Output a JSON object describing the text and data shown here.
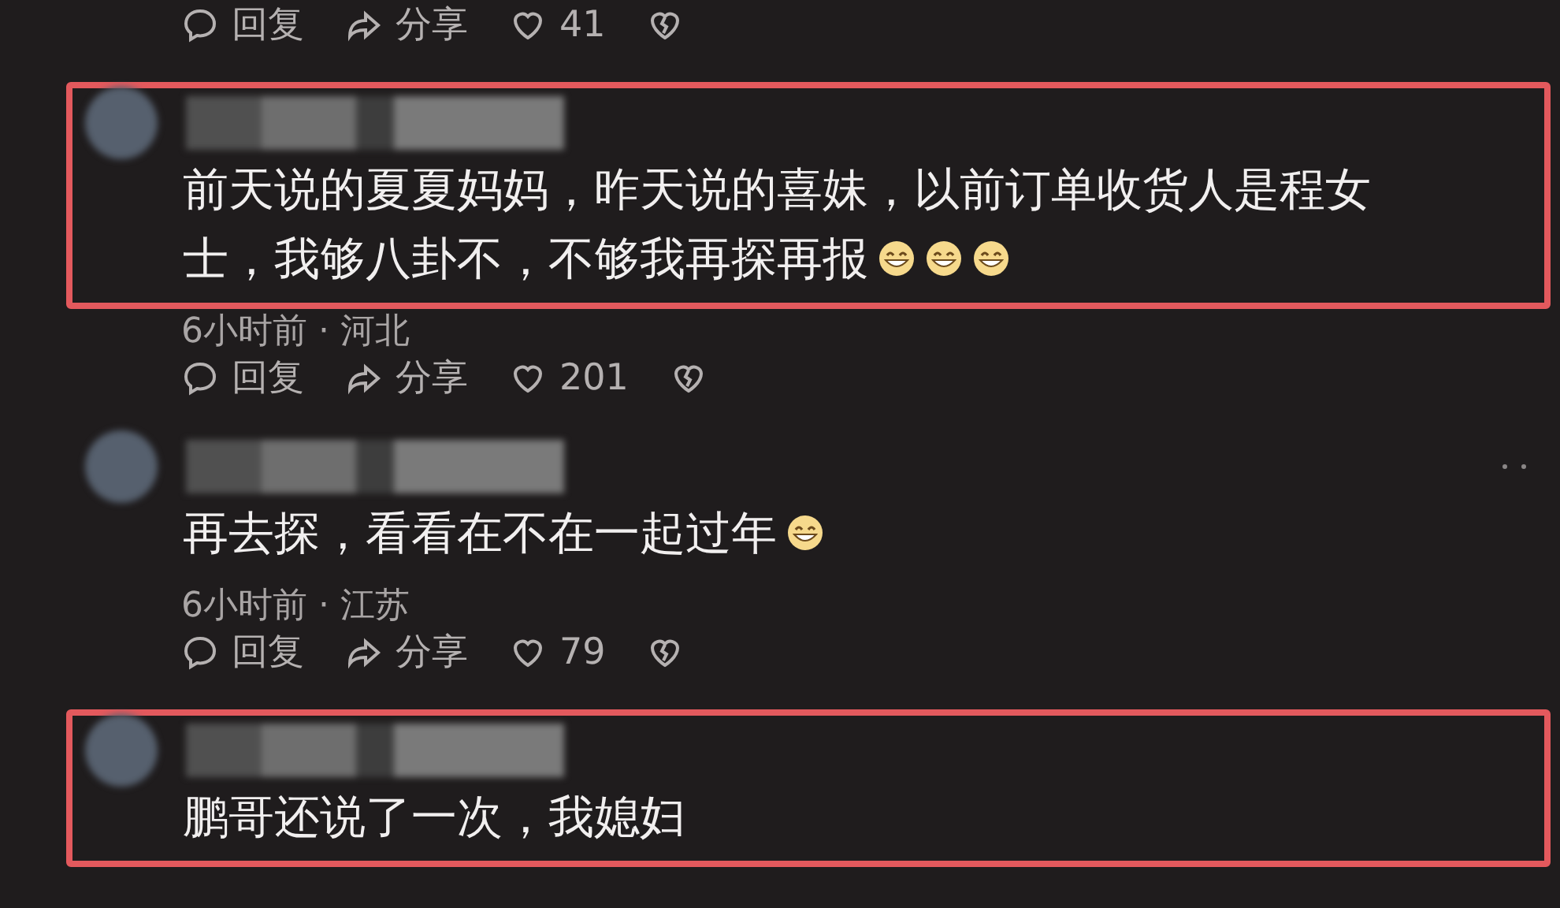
{
  "top_actions": {
    "reply": "回复",
    "share": "分享",
    "likes": "41"
  },
  "comments": [
    {
      "highlighted": true,
      "lines": [
        "前天说的夏夏妈妈，昨天说的喜妹，以前订单收货人是程女",
        "士，我够八卦不，不够我再探再报"
      ],
      "emojis": [
        {
          "kind": "grin"
        },
        {
          "kind": "grin"
        },
        {
          "kind": "grin"
        }
      ],
      "meta": "6小时前 · 河北",
      "actions": {
        "reply": "回复",
        "share": "分享",
        "likes": "201"
      }
    },
    {
      "highlighted": false,
      "lines": [
        "再去探，看看在不在一起过年"
      ],
      "emojis": [
        {
          "kind": "grin"
        }
      ],
      "meta": "6小时前 · 江苏",
      "actions": {
        "reply": "回复",
        "share": "分享",
        "likes": "79"
      }
    },
    {
      "highlighted": true,
      "lines": [
        "鹏哥还说了一次，我媳妇"
      ]
    }
  ]
}
